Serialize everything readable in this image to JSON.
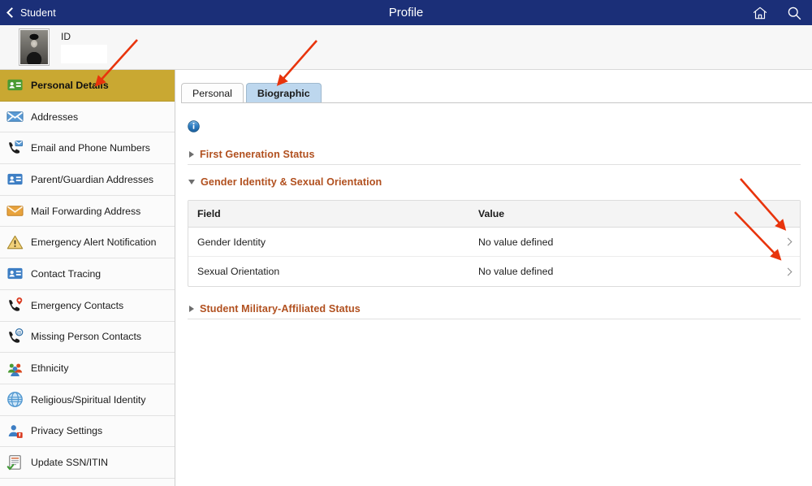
{
  "topbar": {
    "back_label": "Student",
    "title": "Profile",
    "home_icon": "home-icon",
    "search_icon": "search-icon",
    "background": "#1b2f78"
  },
  "identity": {
    "id_label": "ID",
    "id_value": "",
    "photo_alt": "student-photo"
  },
  "sidebar": {
    "active_color": "#c9a832",
    "items": [
      {
        "label": "Personal Details",
        "icon": "id-card-green-icon",
        "active": true
      },
      {
        "label": "Addresses",
        "icon": "envelope-blue-icon",
        "active": false
      },
      {
        "label": "Email and Phone Numbers",
        "icon": "phone-email-icon",
        "active": false
      },
      {
        "label": "Parent/Guardian Addresses",
        "icon": "id-card-blue-icon",
        "active": false
      },
      {
        "label": "Mail Forwarding Address",
        "icon": "envelope-orange-icon",
        "active": false
      },
      {
        "label": "Emergency Alert Notification",
        "icon": "warning-triangle-icon",
        "active": false
      },
      {
        "label": "Contact Tracing",
        "icon": "id-card-blue-icon",
        "active": false
      },
      {
        "label": "Emergency Contacts",
        "icon": "phone-pin-icon",
        "active": false
      },
      {
        "label": "Missing Person Contacts",
        "icon": "phone-at-icon",
        "active": false
      },
      {
        "label": "Ethnicity",
        "icon": "people-group-icon",
        "active": false
      },
      {
        "label": "Religious/Spiritual Identity",
        "icon": "globe-icon",
        "active": false
      },
      {
        "label": "Privacy Settings",
        "icon": "person-lock-icon",
        "active": false
      },
      {
        "label": "Update SSN/ITIN",
        "icon": "document-check-icon",
        "active": false
      }
    ]
  },
  "main": {
    "tabs": [
      {
        "label": "Personal",
        "active": false
      },
      {
        "label": "Biographic",
        "active": true
      }
    ],
    "info_icon": "info-icon",
    "sections": [
      {
        "title": "First Generation Status",
        "expanded": false
      },
      {
        "title": "Gender Identity & Sexual Orientation",
        "expanded": true
      },
      {
        "title": "Student Military-Affiliated Status",
        "expanded": false
      }
    ],
    "section_title_color": "#b1501f",
    "table": {
      "columns": [
        "Field",
        "Value"
      ],
      "rows": [
        {
          "field": "Gender Identity",
          "value": "No value defined",
          "chevron": "chevron-right-icon"
        },
        {
          "field": "Sexual Orientation",
          "value": "No value defined",
          "chevron": "chevron-right-icon"
        }
      ]
    }
  },
  "annotations": {
    "color": "#e8340c",
    "arrows": [
      {
        "name": "arrow-to-personal-details"
      },
      {
        "name": "arrow-to-biographic-tab"
      },
      {
        "name": "arrow-to-gender-identity-chevron"
      },
      {
        "name": "arrow-to-sexual-orientation-chevron"
      }
    ]
  }
}
